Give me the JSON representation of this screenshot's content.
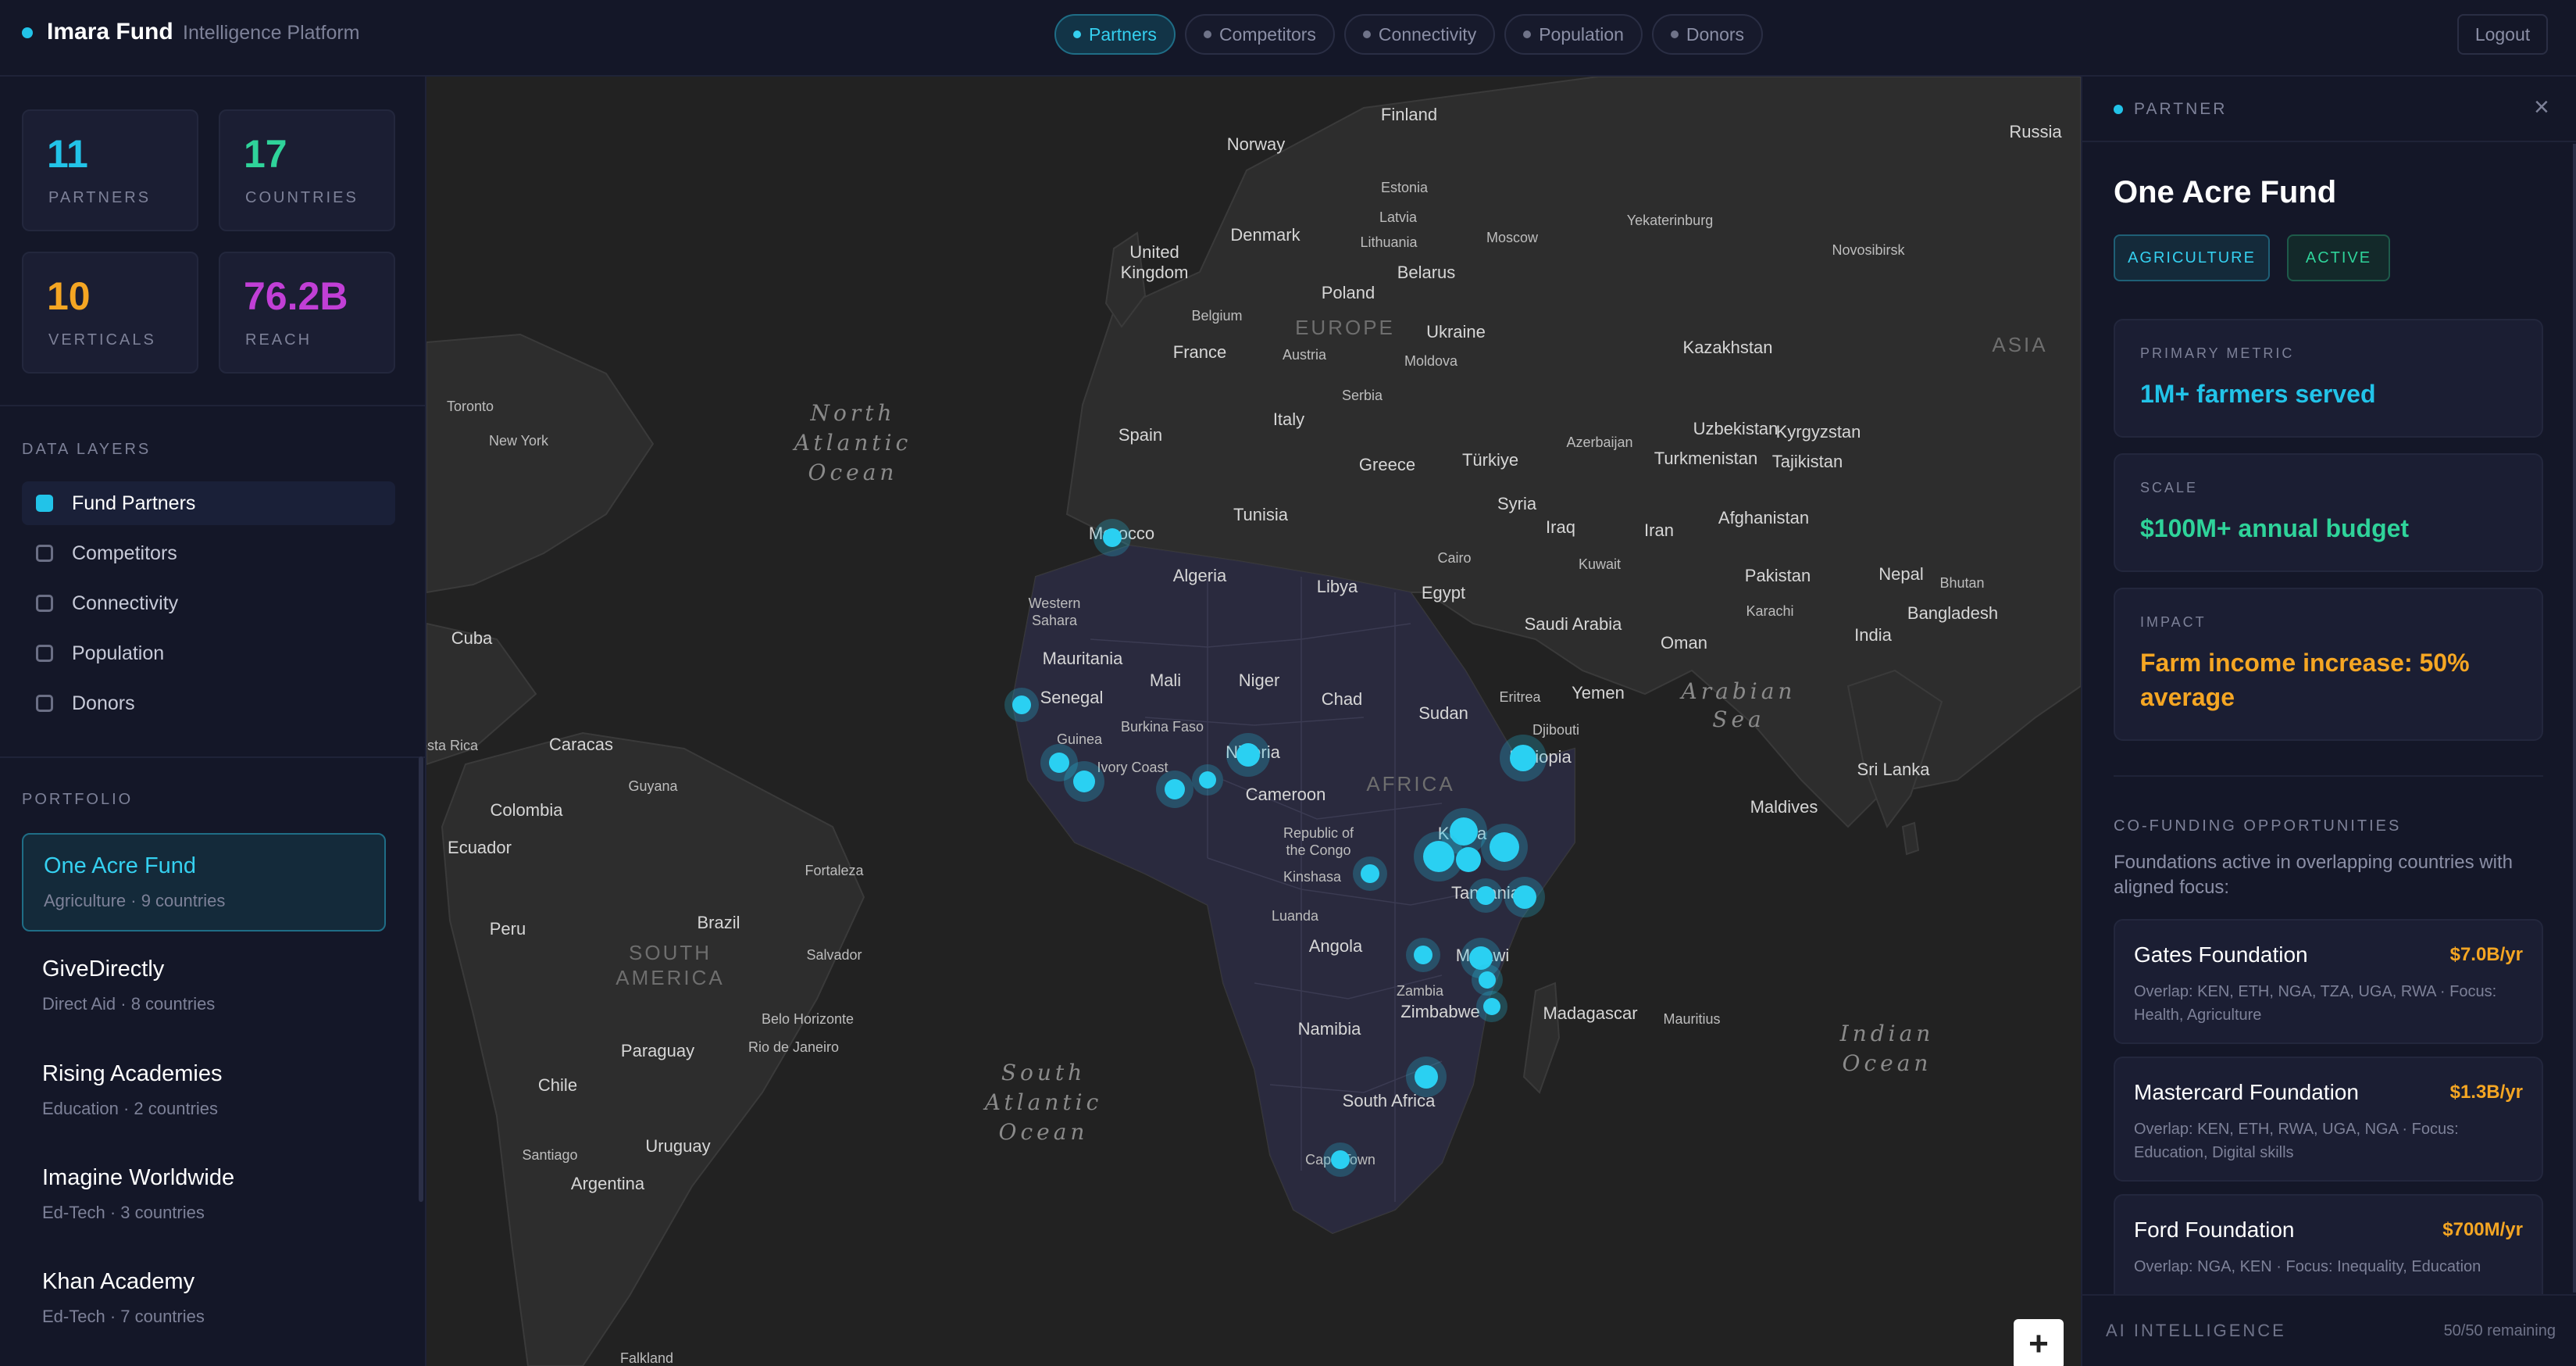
{
  "brand": {
    "name": "Imara Fund",
    "subtitle": "Intelligence Platform"
  },
  "nav": [
    {
      "label": "Partners",
      "active": true
    },
    {
      "label": "Competitors",
      "active": false
    },
    {
      "label": "Connectivity",
      "active": false
    },
    {
      "label": "Population",
      "active": false
    },
    {
      "label": "Donors",
      "active": false
    }
  ],
  "logout_label": "Logout",
  "stats": [
    {
      "value": "11",
      "label": "PARTNERS",
      "color": "#22c3e8"
    },
    {
      "value": "17",
      "label": "COUNTRIES",
      "color": "#2fd39a"
    },
    {
      "value": "10",
      "label": "VERTICALS",
      "color": "#f5a623"
    },
    {
      "value": "76.2B",
      "label": "REACH",
      "color": "#c13fd6"
    }
  ],
  "layers_title": "DATA LAYERS",
  "layers": [
    {
      "label": "Fund Partners",
      "checked": true
    },
    {
      "label": "Competitors",
      "checked": false
    },
    {
      "label": "Connectivity",
      "checked": false
    },
    {
      "label": "Population",
      "checked": false
    },
    {
      "label": "Donors",
      "checked": false
    }
  ],
  "portfolio_title": "PORTFOLIO",
  "portfolio": [
    {
      "name": "One Acre Fund",
      "meta": "Agriculture · 9 countries",
      "active": true
    },
    {
      "name": "GiveDirectly",
      "meta": "Direct Aid · 8 countries",
      "active": false
    },
    {
      "name": "Rising Academies",
      "meta": "Education · 2 countries",
      "active": false
    },
    {
      "name": "Imagine Worldwide",
      "meta": "Ed-Tech · 3 countries",
      "active": false
    },
    {
      "name": "Khan Academy",
      "meta": "Ed-Tech · 7 countries",
      "active": false
    }
  ],
  "map": {
    "oceans": [
      "North",
      "Atlantic",
      "Ocean",
      "South",
      "Atlantic",
      "Ocean",
      "Indian",
      "Ocean",
      "Arabian",
      "Sea"
    ],
    "continents": [
      "EUROPE",
      "AFRICA",
      "SOUTH",
      "AMERICA",
      "ASIA"
    ],
    "places": [
      "Finland",
      "Norway",
      "Russia",
      "Estonia",
      "Latvia",
      "Lithuania",
      "Denmark",
      "United",
      "Kingdom",
      "Moscow",
      "Yekaterinburg",
      "Novosibirsk",
      "Belarus",
      "Poland",
      "Belgium",
      "Ukraine",
      "France",
      "Austria",
      "Moldova",
      "Kazakhstan",
      "Serbia",
      "Italy",
      "Toronto",
      "New York",
      "Spain",
      "Azerbaijan",
      "Uzbekistan",
      "Kyrgyzstan",
      "Greece",
      "Türkiye",
      "Turkmenistan",
      "Tajikistan",
      "Tunisia",
      "Syria",
      "Morocco",
      "Iraq",
      "Iran",
      "Afghanistan",
      "Cairo",
      "Algeria",
      "Libya",
      "Egypt",
      "Kuwait",
      "Pakistan",
      "Nepal",
      "Bhutan",
      "Western",
      "Sahara",
      "Saudi Arabia",
      "Karachi",
      "Bangladesh",
      "Cuba",
      "Mauritania",
      "Mali",
      "Niger",
      "Oman",
      "India",
      "Chad",
      "Sudan",
      "Eritrea",
      "Yemen",
      "Senegal",
      "Djibouti",
      "Caracas",
      "Guinea",
      "Burkina Faso",
      "Nigeria",
      "Ivory Coast",
      "Ethiopia",
      "Sri Lanka",
      "Guyana",
      "Colombia",
      "Cameroon",
      "Maldives",
      "Ecuador",
      "Republic of",
      "the Congo",
      "Kinshasa",
      "Fortaleza",
      "Kenya",
      "Tanzania",
      "Peru",
      "Brazil",
      "Luanda",
      "Salvador",
      "Angola",
      "Malawi",
      "Zambia",
      "Belo Horizonte",
      "Zimbabwe",
      "Madagascar",
      "Mauritius",
      "Rio de Janeiro",
      "Paraguay",
      "Namibia",
      "Chile",
      "South Africa",
      "Santiago",
      "Uruguay",
      "Argentina",
      "Cape Town",
      "Falkland",
      "Costa Rica"
    ],
    "zoom_in_label": "+"
  },
  "partner_panel": {
    "type_label": "PARTNER",
    "close_label": "×",
    "name": "One Acre Fund",
    "tags": [
      "AGRICULTURE",
      "ACTIVE"
    ],
    "metrics": [
      {
        "label": "PRIMARY METRIC",
        "value": "1M+ farmers served",
        "color": "#22c3e8"
      },
      {
        "label": "SCALE",
        "value": "$100M+ annual budget",
        "color": "#2fd39a"
      },
      {
        "label": "IMPACT",
        "value": "Farm income increase: 50% average",
        "color": "#f5a623"
      }
    ],
    "cofunding_title": "CO-FUNDING OPPORTUNITIES",
    "cofunding_desc": "Foundations active in overlapping countries with aligned focus:",
    "foundations": [
      {
        "name": "Gates Foundation",
        "amount": "$7.0B/yr",
        "overlap": "Overlap: KEN, ETH, NGA, TZA, UGA, RWA · Focus: Health, Agriculture"
      },
      {
        "name": "Mastercard Foundation",
        "amount": "$1.3B/yr",
        "overlap": "Overlap: KEN, ETH, RWA, UGA, NGA · Focus: Education, Digital skills"
      },
      {
        "name": "Ford Foundation",
        "amount": "$700M/yr",
        "overlap": "Overlap: NGA, KEN · Focus: Inequality, Education"
      }
    ],
    "ai_title": "AI INTELLIGENCE",
    "ai_count": "50/50 remaining"
  },
  "colors": {
    "accent": "#22c3e8",
    "green": "#2fd39a",
    "orange": "#f5a623",
    "purple": "#c13fd6",
    "map_bg": "#222222"
  }
}
